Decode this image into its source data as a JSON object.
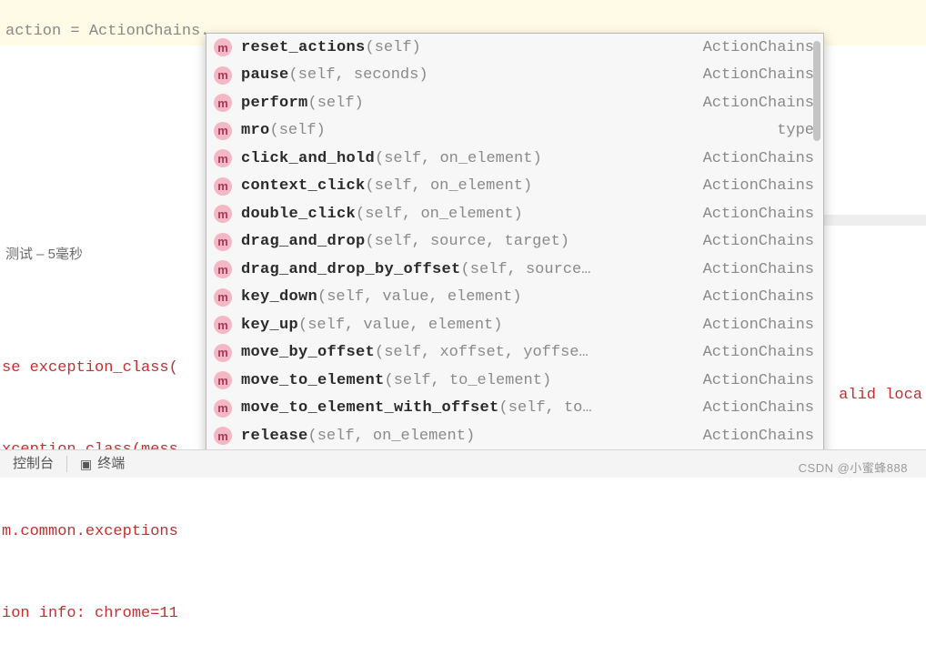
{
  "code": {
    "line1_prefix": "   ",
    "line1_rest": "",
    "line2": "action = ActionChains."
  },
  "autocomplete": {
    "items": [
      {
        "name": "reset_actions",
        "params": "(self)",
        "type": "ActionChains"
      },
      {
        "name": "pause",
        "params": "(self, seconds)",
        "type": "ActionChains"
      },
      {
        "name": "perform",
        "params": "(self)",
        "type": "ActionChains"
      },
      {
        "name": "mro",
        "params": "(self)",
        "type": "type"
      },
      {
        "name": "click_and_hold",
        "params": "(self, on_element)",
        "type": "ActionChains"
      },
      {
        "name": "context_click",
        "params": "(self, on_element)",
        "type": "ActionChains"
      },
      {
        "name": "double_click",
        "params": "(self, on_element)",
        "type": "ActionChains"
      },
      {
        "name": "drag_and_drop",
        "params": "(self, source, target)",
        "type": "ActionChains"
      },
      {
        "name": "drag_and_drop_by_offset",
        "params": "(self, source…",
        "type": "ActionChains"
      },
      {
        "name": "key_down",
        "params": "(self, value, element)",
        "type": "ActionChains"
      },
      {
        "name": "key_up",
        "params": "(self, value, element)",
        "type": "ActionChains"
      },
      {
        "name": "move_by_offset",
        "params": "(self, xoffset, yoffse…",
        "type": "ActionChains"
      },
      {
        "name": "move_to_element",
        "params": "(self, to_element)",
        "type": "ActionChains"
      },
      {
        "name": "move_to_element_with_offset",
        "params": "(self, to…",
        "type": "ActionChains"
      },
      {
        "name": "release",
        "params": "(self, on_element)",
        "type": "ActionChains"
      }
    ],
    "icon_letter": "m"
  },
  "under_text": "测试 – 5毫秒",
  "errors": {
    "l1": "se exception_class(",
    "l2": "xception_class(mess",
    "l3": "m.common.exceptions",
    "l4": "ion info: chrome=11",
    "right": "alid loca"
  },
  "bottom": {
    "tab1": "控制台",
    "tab2": "终端"
  },
  "watermark": "CSDN @小蜜蜂888",
  "hint": ""
}
